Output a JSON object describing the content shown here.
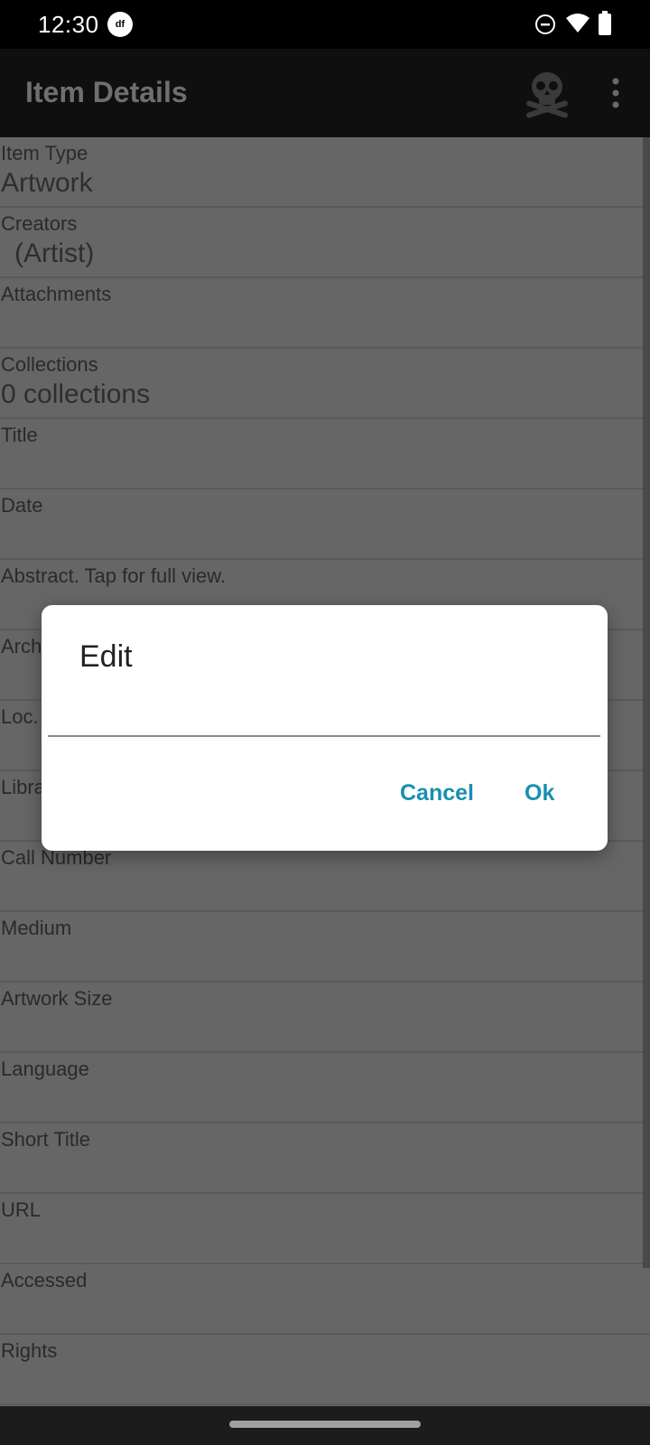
{
  "status_bar": {
    "time": "12:30",
    "app_icon_text": "df"
  },
  "app_bar": {
    "title": "Item Details",
    "skull_icon": "skull-crossbones-icon",
    "overflow_icon": "more-vert-icon"
  },
  "fields": [
    {
      "label": "Item Type",
      "value": "Artwork"
    },
    {
      "label": "Creators",
      "value": "(Artist)"
    },
    {
      "label": "Attachments",
      "value": ""
    },
    {
      "label": "Collections",
      "value": "0 collections"
    },
    {
      "label": "Title",
      "value": ""
    },
    {
      "label": "Date",
      "value": ""
    },
    {
      "label": "Abstract. Tap for full view.",
      "value": ""
    },
    {
      "label": "Arch",
      "value": ""
    },
    {
      "label": "Loc.",
      "value": ""
    },
    {
      "label": "Libra",
      "value": ""
    },
    {
      "label": "Call Number",
      "value": ""
    },
    {
      "label": "Medium",
      "value": ""
    },
    {
      "label": "Artwork Size",
      "value": ""
    },
    {
      "label": "Language",
      "value": ""
    },
    {
      "label": "Short Title",
      "value": ""
    },
    {
      "label": "URL",
      "value": ""
    },
    {
      "label": "Accessed",
      "value": ""
    },
    {
      "label": "Rights",
      "value": ""
    }
  ],
  "dialog": {
    "title": "Edit",
    "input_value": "",
    "cancel_label": "Cancel",
    "ok_label": "Ok"
  },
  "colors": {
    "accent": "#1a8fb0",
    "scrim_background": "#666666"
  }
}
